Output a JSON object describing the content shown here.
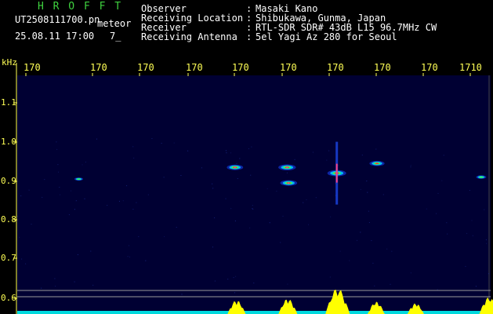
{
  "header": {
    "brand": "H R O F F T",
    "filename": "UT2508111700.pn",
    "subtitle": "meteor",
    "datetime": "25.08.11 17:00",
    "count": "7_",
    "fields": [
      {
        "label": "Observer",
        "value": "Masaki Kano"
      },
      {
        "label": "Receiving Location",
        "value": "Shibukawa, Gunma, Japan"
      },
      {
        "label": "Receiver",
        "value": "RTL-SDR SDR# 43dB L15 96.7MHz CW"
      },
      {
        "label": "Receiving Antenna",
        "value": "5el Yagi Az 280 for Seoul"
      }
    ],
    "separator": ":"
  },
  "colors": {
    "background": "#000000",
    "header_green": "#3fd23f",
    "text": "#ffffff",
    "axis": "#ffff55",
    "plot_bg": "#000033",
    "activity": "#ffff00",
    "baseline": "#00ffff"
  },
  "chart_data": {
    "type": "heatmap",
    "ylabel": "kHz",
    "yticks": [
      "1.1",
      "1.0",
      "0.9",
      "0.8",
      "0.7",
      "0.6"
    ],
    "ylim": [
      0.58,
      1.15
    ],
    "xticks": [
      "170",
      "170",
      "170",
      "170",
      "170",
      "170",
      "170",
      "170",
      "170",
      "1710"
    ],
    "xlim": [
      0,
      60
    ],
    "echoes": [
      {
        "t": 27.6,
        "f": 0.935,
        "intensity": 0.8
      },
      {
        "t": 34.2,
        "f": 0.935,
        "intensity": 0.9
      },
      {
        "t": 34.4,
        "f": 0.895,
        "intensity": 0.85
      },
      {
        "t": 40.5,
        "f": 0.92,
        "intensity": 1.0
      },
      {
        "t": 45.6,
        "f": 0.945,
        "intensity": 0.7
      },
      {
        "t": 7.8,
        "f": 0.905,
        "intensity": 0.2
      },
      {
        "t": 58.8,
        "f": 0.91,
        "intensity": 0.3
      }
    ],
    "activity": [
      {
        "t": 27.8,
        "level": 0.45
      },
      {
        "t": 34.3,
        "level": 0.5
      },
      {
        "t": 40.6,
        "level": 0.85
      },
      {
        "t": 45.5,
        "level": 0.4
      },
      {
        "t": 50.5,
        "level": 0.35
      },
      {
        "t": 59.8,
        "level": 0.55
      }
    ]
  }
}
